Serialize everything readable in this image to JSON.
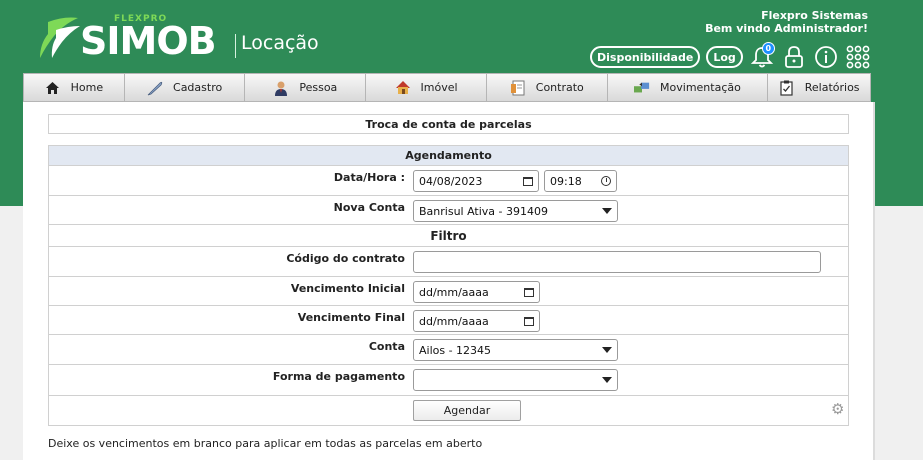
{
  "brand": {
    "top": "FLEXPRO",
    "name": "SIMOB",
    "module": "Locação"
  },
  "header": {
    "company": "Flexpro Sistemas",
    "welcome": "Bem vindo Administrador!",
    "availability_label": "Disponibilidade",
    "log_label": "Log",
    "notification_count": "0"
  },
  "nav": [
    {
      "label": "Home",
      "icon": "home-icon"
    },
    {
      "label": "Cadastro",
      "icon": "feather-icon"
    },
    {
      "label": "Pessoa",
      "icon": "person-icon"
    },
    {
      "label": "Imóvel",
      "icon": "house-icon"
    },
    {
      "label": "Contrato",
      "icon": "document-icon"
    },
    {
      "label": "Movimentação",
      "icon": "transfer-icon"
    },
    {
      "label": "Relatórios",
      "icon": "clipboard-icon"
    }
  ],
  "page": {
    "title": "Troca de conta de parcelas",
    "section_schedule": "Agendamento",
    "section_filter": "Filtro",
    "note": "Deixe os vencimentos em branco para aplicar em todas as parcelas em aberto"
  },
  "form": {
    "datetime_label": "Data/Hora :",
    "date_value": "04/08/2023",
    "time_value": "09:18",
    "new_account_label": "Nova Conta",
    "new_account_value": "Banrisul Ativa - 391409",
    "contract_code_label": "Código do contrato",
    "contract_code_value": "",
    "due_start_label": "Vencimento Inicial",
    "due_start_placeholder": "dd/mm/aaaa",
    "due_end_label": "Vencimento Final",
    "due_end_placeholder": "dd/mm/aaaa",
    "account_label": "Conta",
    "account_value": "Ailos - 12345",
    "payment_label": "Forma de pagamento",
    "payment_value": "",
    "schedule_button": "Agendar"
  },
  "colors": {
    "header_green": "#2e8b57",
    "accent_light_green": "#7ed957",
    "section_header": "#e2e8f2",
    "badge_blue": "#1e90ff"
  }
}
